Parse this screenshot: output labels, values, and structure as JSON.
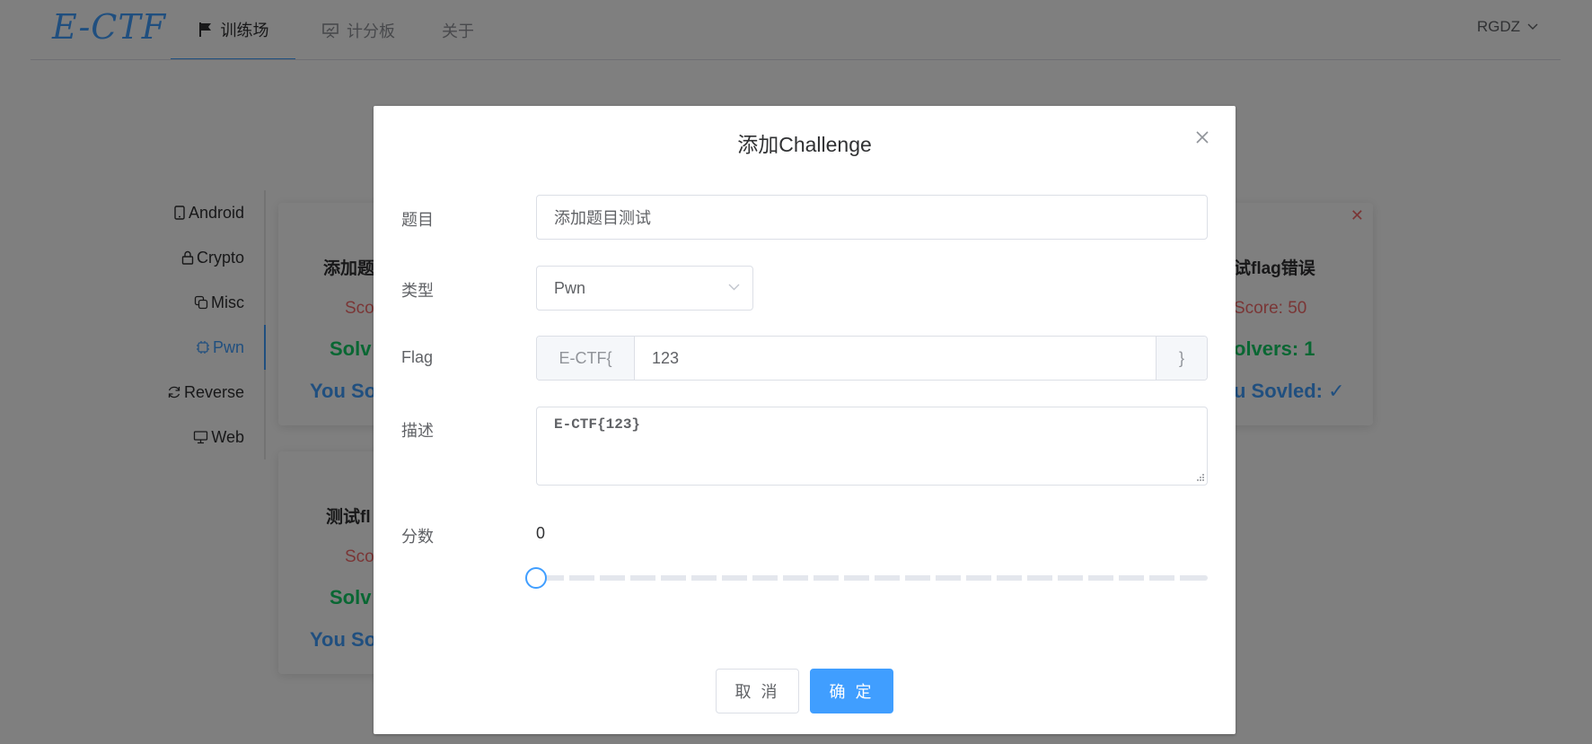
{
  "app": {
    "logo": "E-CTF"
  },
  "nav": {
    "training": "训练场",
    "scoreboard": "计分板",
    "about": "关于",
    "user": "RGDZ"
  },
  "sidebar": {
    "items": [
      {
        "label": "Android",
        "icon": "mobile-icon"
      },
      {
        "label": "Crypto",
        "icon": "lock-icon"
      },
      {
        "label": "Misc",
        "icon": "copy-icon"
      },
      {
        "label": "Pwn",
        "icon": "cpu-icon"
      },
      {
        "label": "Reverse",
        "icon": "refresh-icon"
      },
      {
        "label": "Web",
        "icon": "monitor-icon"
      }
    ],
    "active": "Pwn"
  },
  "cards": [
    {
      "title": "添加题",
      "score": "Sco",
      "solvers": "Solv",
      "you": "You So"
    },
    {
      "title": "试flag错误",
      "score": "Score: 50",
      "solvers": "olvers: 1",
      "you": "u Sovled: ✓"
    },
    {
      "title": "测试fl",
      "score": "Sco",
      "solvers": "Solv",
      "you": "You So"
    }
  ],
  "dialog": {
    "title": "添加Challenge",
    "fields": {
      "title_label": "题目",
      "title_value": "添加题目测试",
      "type_label": "类型",
      "type_value": "Pwn",
      "flag_label": "Flag",
      "flag_prefix": "E-CTF{",
      "flag_value": "123",
      "flag_suffix": "}",
      "desc_label": "描述",
      "desc_value": "E-CTF{123}",
      "score_label": "分数",
      "score_value": "0"
    },
    "slider": {
      "value": 0,
      "min": 0,
      "max": 100
    },
    "buttons": {
      "cancel": "取 消",
      "ok": "确 定"
    }
  },
  "colors": {
    "primary": "#409eff",
    "danger": "#f56c6c",
    "success": "#13ce66"
  }
}
